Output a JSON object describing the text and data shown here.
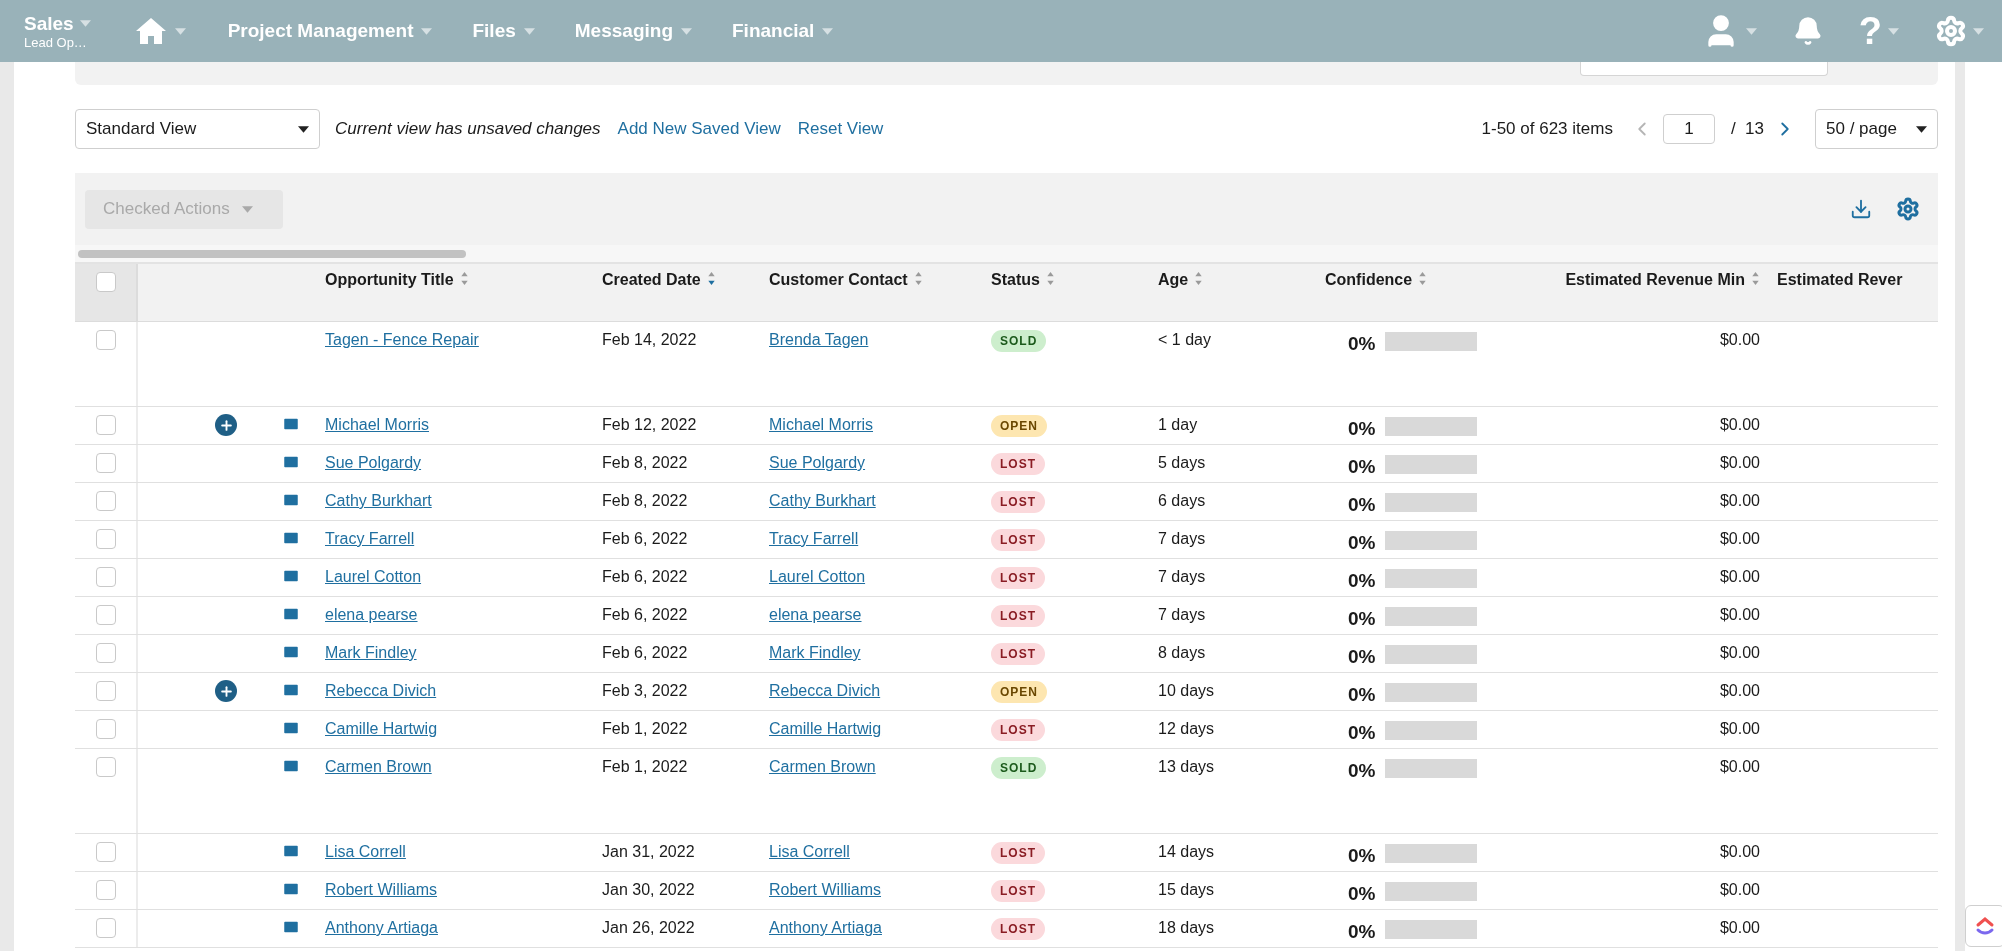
{
  "nav": {
    "left": [
      {
        "kind": "module",
        "label": "Sales",
        "sublabel": "Lead Op…"
      },
      {
        "kind": "home"
      },
      {
        "kind": "menu",
        "label": "Project Management"
      },
      {
        "kind": "menu",
        "label": "Files"
      },
      {
        "kind": "menu",
        "label": "Messaging"
      },
      {
        "kind": "menu",
        "label": "Financial"
      }
    ],
    "right": [
      {
        "kind": "user",
        "caret": true
      },
      {
        "kind": "bell",
        "caret": false
      },
      {
        "kind": "help",
        "glyph": "?",
        "caret": true
      },
      {
        "kind": "gear",
        "caret": true
      }
    ]
  },
  "view_bar": {
    "view_select": "Standard View",
    "notice": "Current view has unsaved changes",
    "links": [
      "Add New Saved View",
      "Reset View"
    ],
    "pagination": {
      "range": "1-50 of 623 items",
      "page": "1",
      "total": "/  13",
      "per_page": "50 / page"
    }
  },
  "toolbar": {
    "checked_actions": {
      "label": "Checked Actions",
      "disabled": true
    }
  },
  "table": {
    "select_all_checked": false,
    "columns": [
      {
        "label": "Opportunity Title",
        "sorted": false
      },
      {
        "label": "Created Date",
        "sorted": true
      },
      {
        "label": "Customer Contact",
        "sorted": false
      },
      {
        "label": "Status",
        "sorted": false
      },
      {
        "label": "Age",
        "sorted": false
      },
      {
        "label": "Confidence",
        "sorted": false
      },
      {
        "label": "Estimated Revenue Min",
        "sorted": false
      },
      {
        "label": "Estimated Rever"
      }
    ],
    "rows": [
      {
        "checked": false,
        "add": false,
        "mail": false,
        "tall": true,
        "title": "Tagen - Fence Repair",
        "created": "Feb 14, 2022",
        "contact": "Brenda Tagen",
        "status": {
          "kind": "sold",
          "label": "SOLD"
        },
        "age": "< 1 day",
        "confidence": "0%",
        "level": 0,
        "revenue_min": "$0.00"
      },
      {
        "checked": false,
        "add": true,
        "mail": true,
        "tall": false,
        "title": "Michael Morris",
        "created": "Feb 12, 2022",
        "contact": "Michael Morris",
        "status": {
          "kind": "open",
          "label": "OPEN"
        },
        "age": "1 day",
        "confidence": "0%",
        "level": 0,
        "revenue_min": "$0.00"
      },
      {
        "checked": false,
        "add": false,
        "mail": true,
        "tall": false,
        "title": "Sue Polgardy",
        "created": "Feb 8, 2022",
        "contact": "Sue Polgardy",
        "status": {
          "kind": "lost",
          "label": "LOST"
        },
        "age": "5 days",
        "confidence": "0%",
        "level": 0,
        "revenue_min": "$0.00"
      },
      {
        "checked": false,
        "add": false,
        "mail": true,
        "tall": false,
        "title": "Cathy Burkhart",
        "created": "Feb 8, 2022",
        "contact": "Cathy Burkhart",
        "status": {
          "kind": "lost",
          "label": "LOST"
        },
        "age": "6 days",
        "confidence": "0%",
        "level": 0,
        "revenue_min": "$0.00"
      },
      {
        "checked": false,
        "add": false,
        "mail": true,
        "tall": false,
        "title": "Tracy Farrell",
        "created": "Feb 6, 2022",
        "contact": "Tracy Farrell",
        "status": {
          "kind": "lost",
          "label": "LOST"
        },
        "age": "7 days",
        "confidence": "0%",
        "level": 0,
        "revenue_min": "$0.00"
      },
      {
        "checked": false,
        "add": false,
        "mail": true,
        "tall": false,
        "title": "Laurel Cotton",
        "created": "Feb 6, 2022",
        "contact": "Laurel Cotton",
        "status": {
          "kind": "lost",
          "label": "LOST"
        },
        "age": "7 days",
        "confidence": "0%",
        "level": 0,
        "revenue_min": "$0.00"
      },
      {
        "checked": false,
        "add": false,
        "mail": true,
        "tall": false,
        "title": "elena pearse",
        "created": "Feb 6, 2022",
        "contact": "elena pearse",
        "status": {
          "kind": "lost",
          "label": "LOST"
        },
        "age": "7 days",
        "confidence": "0%",
        "level": 0,
        "revenue_min": "$0.00"
      },
      {
        "checked": false,
        "add": false,
        "mail": true,
        "tall": false,
        "title": "Mark Findley",
        "created": "Feb 6, 2022",
        "contact": "Mark Findley",
        "status": {
          "kind": "lost",
          "label": "LOST"
        },
        "age": "8 days",
        "confidence": "0%",
        "level": 0,
        "revenue_min": "$0.00"
      },
      {
        "checked": false,
        "add": true,
        "mail": true,
        "tall": false,
        "title": "Rebecca Divich",
        "created": "Feb 3, 2022",
        "contact": "Rebecca Divich",
        "status": {
          "kind": "open",
          "label": "OPEN"
        },
        "age": "10 days",
        "confidence": "0%",
        "level": 0,
        "revenue_min": "$0.00"
      },
      {
        "checked": false,
        "add": false,
        "mail": true,
        "tall": false,
        "title": "Camille Hartwig",
        "created": "Feb 1, 2022",
        "contact": "Camille Hartwig",
        "status": {
          "kind": "lost",
          "label": "LOST"
        },
        "age": "12 days",
        "confidence": "0%",
        "level": 0,
        "revenue_min": "$0.00"
      },
      {
        "checked": false,
        "add": false,
        "mail": true,
        "tall": true,
        "title": "Carmen Brown",
        "created": "Feb 1, 2022",
        "contact": "Carmen Brown",
        "status": {
          "kind": "sold",
          "label": "SOLD"
        },
        "age": "13 days",
        "confidence": "0%",
        "level": 0,
        "revenue_min": "$0.00"
      },
      {
        "checked": false,
        "add": false,
        "mail": true,
        "tall": false,
        "title": "Lisa Correll",
        "created": "Jan 31, 2022",
        "contact": "Lisa Correll",
        "status": {
          "kind": "lost",
          "label": "LOST"
        },
        "age": "14 days",
        "confidence": "0%",
        "level": 0,
        "revenue_min": "$0.00"
      },
      {
        "checked": false,
        "add": false,
        "mail": true,
        "tall": false,
        "title": "Robert Williams",
        "created": "Jan 30, 2022",
        "contact": "Robert Williams",
        "status": {
          "kind": "lost",
          "label": "LOST"
        },
        "age": "15 days",
        "confidence": "0%",
        "level": 0,
        "revenue_min": "$0.00"
      },
      {
        "checked": false,
        "add": false,
        "mail": true,
        "tall": false,
        "title": "Anthony Artiaga",
        "created": "Jan 26, 2022",
        "contact": "Anthony Artiaga",
        "status": {
          "kind": "lost",
          "label": "LOST"
        },
        "age": "18 days",
        "confidence": "0%",
        "level": 0,
        "revenue_min": "$0.00"
      }
    ]
  }
}
